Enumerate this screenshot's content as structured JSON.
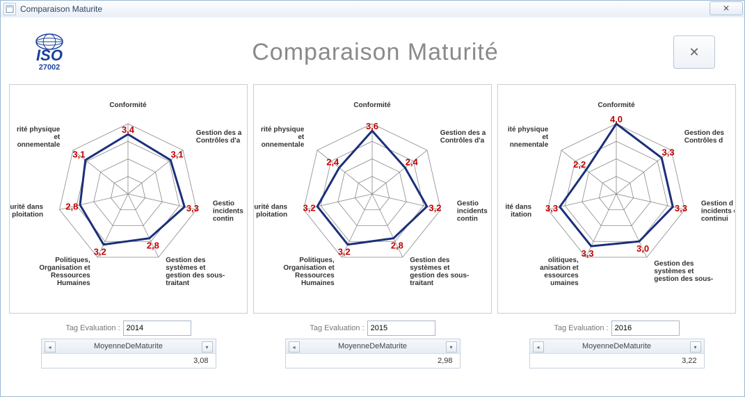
{
  "window_title": "Comparaison Maturite",
  "header": {
    "logo_text": "ISO",
    "logo_number": "27002",
    "title": "Comparaison Maturité",
    "close_symbol": "✕"
  },
  "labels": {
    "tag_evaluation": "Tag Evaluation :",
    "metric_name": "MoyenneDeMaturite"
  },
  "axes": [
    "Conformité",
    "Gestion des actifs et Contrôles d'accès",
    "Gestion incidents continuité",
    "Gestion des systèmes et gestion des sous-traitant",
    "Politiques, Organisation et Ressources Humaines",
    "Sécurité dans l'exploitation",
    "Sécurité physique et environnementale"
  ],
  "axes_short": [
    [
      "Conformité"
    ],
    [
      "Gestion des a",
      "Contrôles d'a"
    ],
    [
      "Gestio",
      "incidents",
      "contin"
    ],
    [
      "Gestion des",
      "systèmes et",
      "gestion des sous-",
      "traitant"
    ],
    [
      "Politiques,",
      "Organisation et",
      "Ressources",
      "Humaines"
    ],
    [
      "urité dans",
      "ploitation"
    ],
    [
      "rité physique",
      "et",
      "onnementale"
    ]
  ],
  "axes_short_p3": [
    [
      "Conformité"
    ],
    [
      "Gestion des",
      "Contrôles d"
    ],
    [
      "Gestion d",
      "incidents et",
      "continui"
    ],
    [
      "Gestion des",
      "systèmes et",
      "gestion des sous-"
    ],
    [
      "olitiques,",
      "anisation et",
      "essources",
      "umaines"
    ],
    [
      "ité dans",
      "itation"
    ],
    [
      "ité physique",
      "et",
      "nnementale"
    ]
  ],
  "chart_data": [
    {
      "type": "radar",
      "tag": "2014",
      "mean": "3,08",
      "values": [
        3.4,
        3.1,
        3.3,
        2.8,
        3.2,
        2.8,
        3.1
      ],
      "value_labels": [
        "3,4",
        "3,1",
        "3,3",
        "2,8",
        "3,2",
        "2,8",
        "3,1"
      ],
      "max": 4
    },
    {
      "type": "radar",
      "tag": "2015",
      "mean": "2,98",
      "values": [
        3.6,
        2.4,
        3.2,
        2.8,
        3.2,
        3.2,
        2.4
      ],
      "value_labels": [
        "3,6",
        "2,4",
        "3,2",
        "2,8",
        "3,2",
        "3,2",
        "2,4"
      ],
      "max": 4
    },
    {
      "type": "radar",
      "tag": "2016",
      "mean": "3,22",
      "values": [
        4.0,
        3.3,
        3.3,
        3.0,
        3.3,
        3.3,
        2.2
      ],
      "value_labels": [
        "4,0",
        "3,3",
        "3,3",
        "3,0",
        "3,3",
        "3,3",
        "2,2"
      ],
      "max": 4
    }
  ]
}
